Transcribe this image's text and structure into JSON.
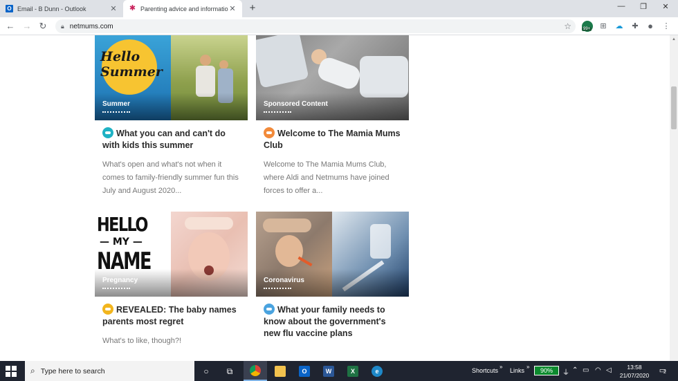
{
  "browser": {
    "tabs": [
      {
        "title": "Email - B Dunn - Outlook",
        "active": false
      },
      {
        "title": "Parenting advice and information",
        "active": true
      }
    ],
    "url": "netmums.com",
    "extension_badge": "99+"
  },
  "articles": [
    {
      "category": "Summer",
      "title": "What you can and can't do with kids this summer",
      "excerpt": "What's open and what's not when it comes to family-friendly summer fun this July and August 2020...",
      "badge_color": "#1fb2c4",
      "image_text": "Hello Summer"
    },
    {
      "category": "Sponsored Content",
      "title": "Welcome to The Mamia Mums Club",
      "excerpt": "Welcome to The Mamia Mums Club, where Aldi and Netmums have joined forces to offer a...",
      "badge_color": "#f28a3a"
    },
    {
      "category": "Pregnancy",
      "title": "REVEALED: The baby names parents most regret",
      "excerpt": "What's to like, though?!",
      "badge_color": "#f2b51d",
      "image_text": [
        "HELLO",
        "— MY —",
        "NAME"
      ]
    },
    {
      "category": "Coronavirus",
      "title": "What your family needs to know about the government's new flu vaccine plans",
      "excerpt": "",
      "badge_color": "#4aa3df"
    }
  ],
  "taskbar": {
    "search_placeholder": "Type here to search",
    "shortcuts_label": "Shortcuts",
    "links_label": "Links",
    "battery": "90%",
    "time": "13:58",
    "date": "21/07/2020",
    "notification_count": "2"
  }
}
